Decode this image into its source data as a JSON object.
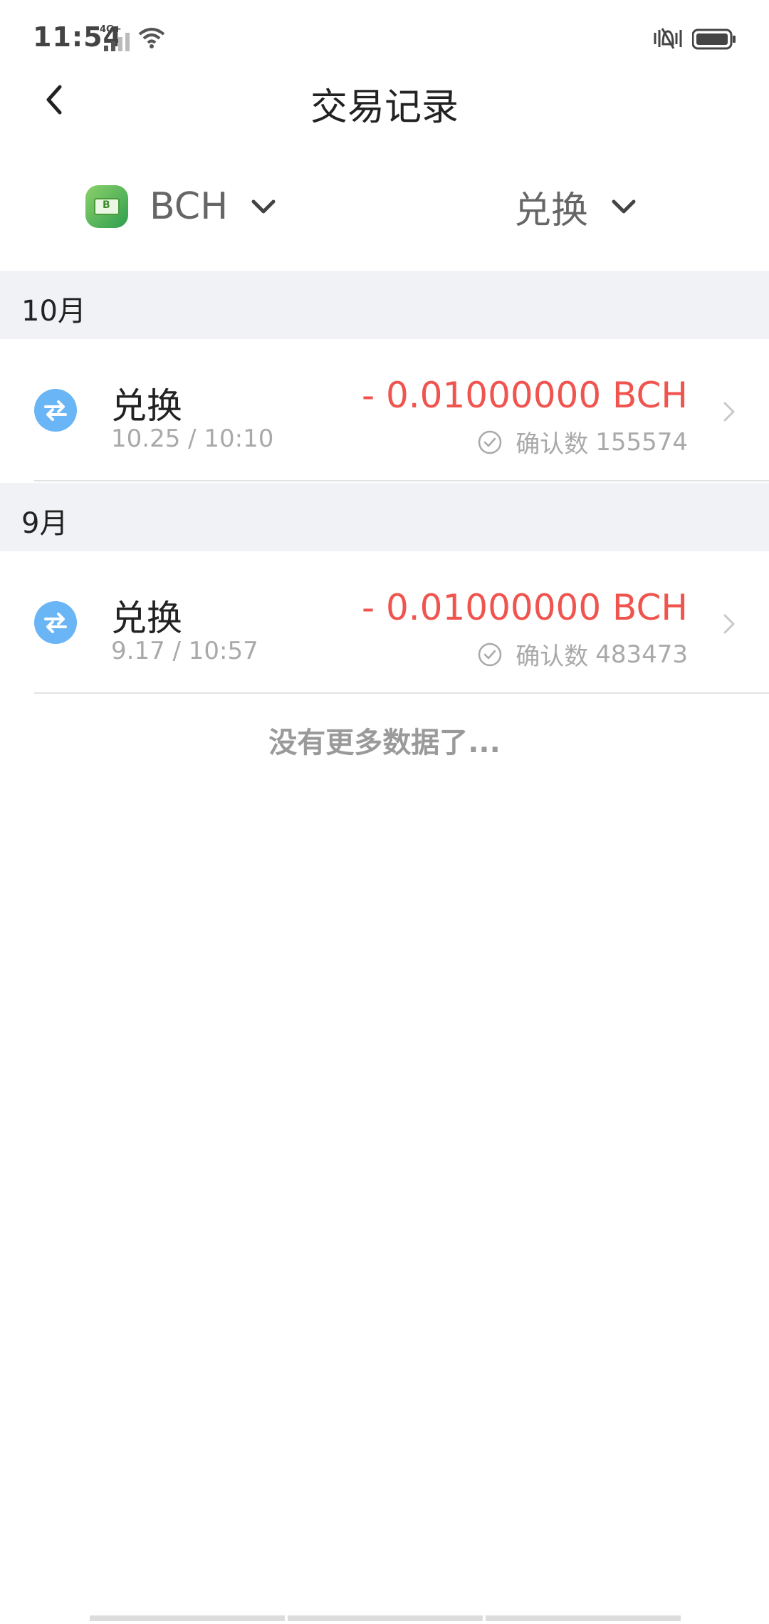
{
  "status_bar": {
    "time": "11:54",
    "network": "4G+"
  },
  "header": {
    "title": "交易记录"
  },
  "filters": {
    "coin": "BCH",
    "type": "兑换"
  },
  "sections": [
    {
      "month": "10月",
      "transactions": [
        {
          "type": "兑换",
          "datetime": "10.25 / 10:10",
          "amount": "- 0.01000000 BCH",
          "confirm_label": "确认数",
          "confirmations": "155574"
        }
      ]
    },
    {
      "month": "9月",
      "transactions": [
        {
          "type": "兑换",
          "datetime": "9.17 / 10:57",
          "amount": "- 0.01000000 BCH",
          "confirm_label": "确认数",
          "confirmations": "483473"
        }
      ]
    }
  ],
  "footer": {
    "no_more_text": "没有更多数据了..."
  },
  "colors": {
    "amount_negative": "#f0544f",
    "swap_icon_bg": "#69b5f5",
    "section_bg": "#f1f2f6"
  }
}
